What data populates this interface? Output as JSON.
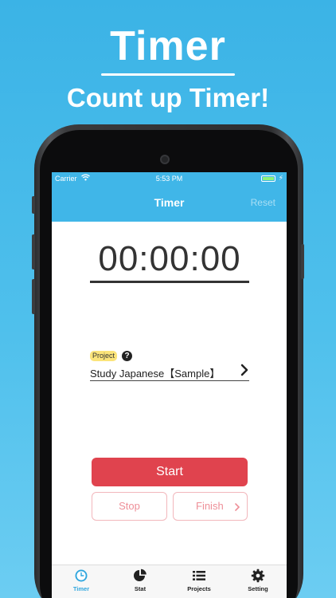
{
  "headline": {
    "title": "Timer",
    "subtitle": "Count up Timer!"
  },
  "status_bar": {
    "carrier": "Carrier",
    "time": "5:53 PM"
  },
  "nav": {
    "title": "Timer",
    "reset_label": "Reset"
  },
  "timer": {
    "display": "00:00:00"
  },
  "project": {
    "tag": "Project",
    "help": "?",
    "name": "Study Japanese【Sample】"
  },
  "buttons": {
    "start": "Start",
    "stop": "Stop",
    "finish": "Finish"
  },
  "tabs": [
    {
      "label": "Timer",
      "icon": "clock-icon"
    },
    {
      "label": "Stat",
      "icon": "pie-chart-icon"
    },
    {
      "label": "Projects",
      "icon": "list-icon"
    },
    {
      "label": "Setting",
      "icon": "gear-icon"
    }
  ],
  "colors": {
    "accent": "#40b6e8",
    "start_button": "#e0434e",
    "tab_active": "#2fa6de",
    "project_tag": "#fbe47a"
  }
}
